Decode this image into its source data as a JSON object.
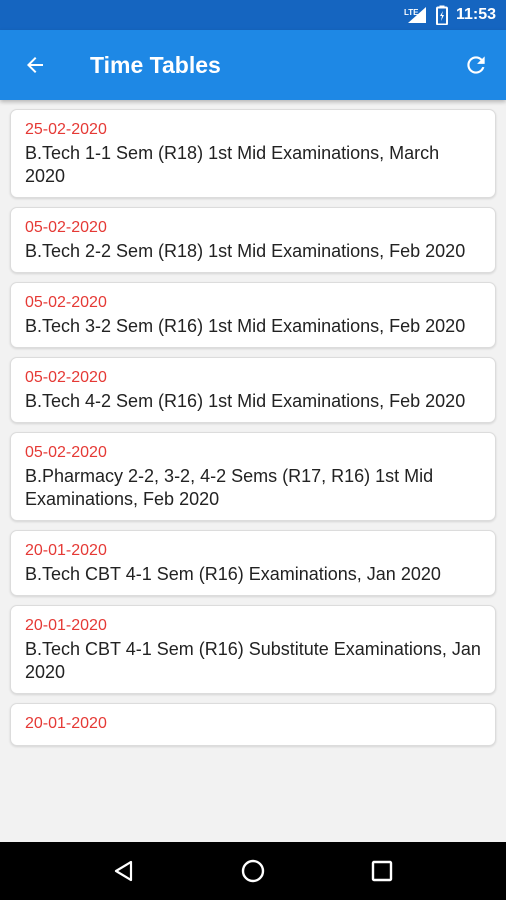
{
  "status_bar": {
    "network_label": "LTE",
    "time": "11:53",
    "icons": [
      "lte-signal-icon",
      "battery-icon"
    ]
  },
  "app_bar": {
    "title": "Time Tables",
    "back_icon": "arrow-left-icon",
    "refresh_icon": "refresh-icon"
  },
  "items": [
    {
      "date": "25-02-2020",
      "title": "B.Tech 1-1 Sem (R18) 1st Mid Examinations, March 2020"
    },
    {
      "date": "05-02-2020",
      "title": "B.Tech 2-2 Sem (R18) 1st Mid Examinations, Feb 2020"
    },
    {
      "date": "05-02-2020",
      "title": "B.Tech 3-2 Sem (R16) 1st Mid Examinations, Feb 2020"
    },
    {
      "date": "05-02-2020",
      "title": "B.Tech 4-2 Sem (R16) 1st Mid Examinations, Feb 2020"
    },
    {
      "date": "05-02-2020",
      "title": "B.Pharmacy 2-2, 3-2, 4-2 Sems (R17, R16) 1st Mid Examinations, Feb 2020"
    },
    {
      "date": "20-01-2020",
      "title": "B.Tech CBT 4-1 Sem (R16) Examinations, Jan 2020"
    },
    {
      "date": "20-01-2020",
      "title": "B.Tech CBT 4-1 Sem (R16) Substitute Examinations, Jan 2020"
    },
    {
      "date": "20-01-2020",
      "title": ""
    }
  ],
  "colors": {
    "status_bar": "#1565c0",
    "app_bar": "#1e88e5",
    "date_text": "#e53935",
    "nav_bar": "#000000"
  },
  "nav_bar": {
    "icons": [
      "back-triangle-icon",
      "home-circle-icon",
      "recents-square-icon"
    ]
  }
}
